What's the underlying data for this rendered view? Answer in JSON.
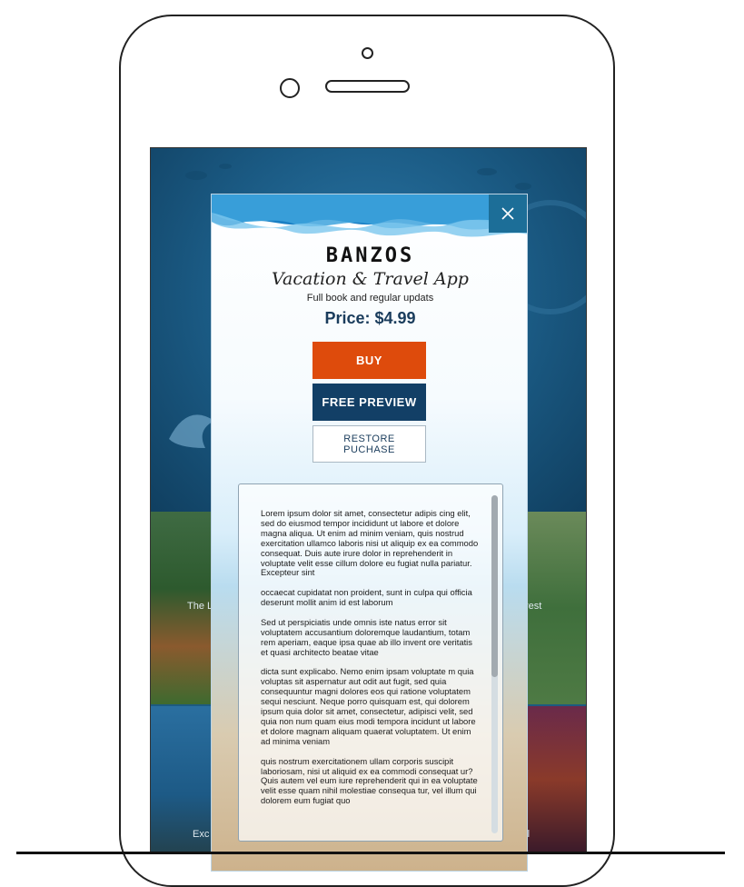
{
  "app": {
    "brand": "BANZOS",
    "subtitle": "Vacation & Travel App",
    "tagline": "Full book and regular updats",
    "price": "Price: $4.99"
  },
  "buttons": {
    "buy": "BUY",
    "free_preview": "FREE PREVIEW",
    "restore": "RESTORE PUCHASE",
    "close_icon": "close-icon"
  },
  "background_captions": {
    "left_top": "The L",
    "right_top": "rest",
    "left_bottom": "Exc",
    "right_bottom": "al'l"
  },
  "description": {
    "paragraphs": [
      "Lorem ipsum dolor sit amet, consectetur adipis cing elit, sed do eiusmod tempor incididunt ut labore et dolore magna aliqua. Ut enim ad minim veniam, quis nostrud exercitation ullamco laboris nisi ut aliquip ex ea commodo consequat. Duis aute irure dolor in reprehenderit in voluptate velit esse cillum dolore eu fugiat nulla pariatur. Excepteur sint",
      "occaecat cupidatat non proident, sunt in culpa qui officia deserunt mollit anim id est laborum",
      "Sed ut perspiciatis unde omnis iste natus error sit voluptatem accusantium doloremque laudantium, totam rem aperiam, eaque ipsa quae ab illo invent ore veritatis et quasi architecto beatae vitae",
      "dicta sunt explicabo. Nemo enim ipsam voluptate m quia voluptas sit aspernatur aut odit aut fugit, sed quia consequuntur magni dolores eos qui ratione voluptatem sequi nesciunt. Neque porro quisquam est, qui dolorem ipsum quia dolor sit amet, consectetur, adipisci velit, sed quia non num quam eius modi tempora incidunt ut labore et dolore magnam aliquam quaerat voluptatem. Ut enim ad minima veniam",
      "quis nostrum exercitationem ullam corporis suscipit laboriosam, nisi ut aliquid ex ea commodi consequat ur? Quis autem vel eum iure reprehenderit qui in ea voluptate velit esse quam nihil molestiae consequa tur, vel illum qui dolorem eum fugiat quo"
    ]
  },
  "colors": {
    "buy": "#de4b0c",
    "preview": "#123f66",
    "accent": "#1c6e98"
  }
}
